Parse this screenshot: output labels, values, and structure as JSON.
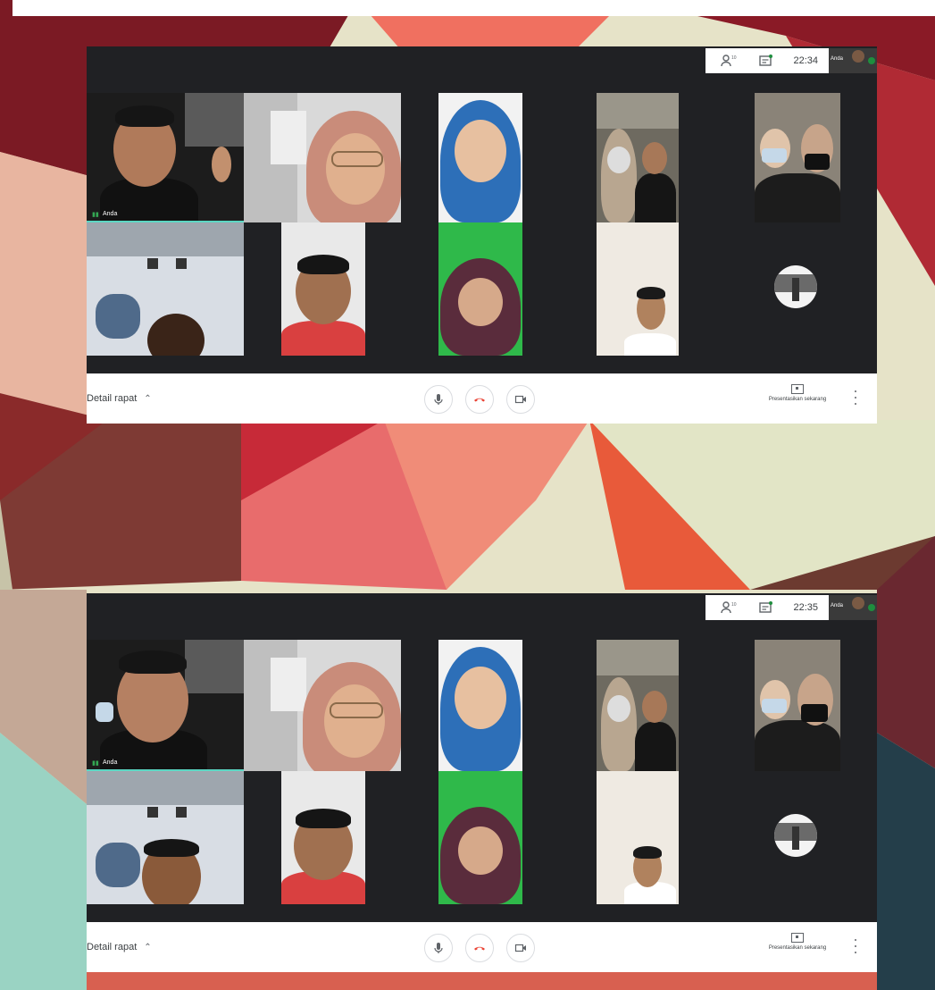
{
  "screens": [
    {
      "clock": "22:34",
      "self_label": "Anda",
      "first_tile_name": "Anda",
      "detail_label": "Detail rapat",
      "present_label": "Presentasikan sekarang"
    },
    {
      "clock": "22:35",
      "self_label": "Anda",
      "first_tile_name": "Anda",
      "detail_label": "Detail rapat",
      "present_label": "Presentasikan sekarang"
    }
  ],
  "icons": {
    "people": "people-icon",
    "chat": "chat-icon",
    "expand": "chevron-up-icon",
    "mic": "microphone-icon",
    "hangup": "hang-up-icon",
    "camera": "camera-icon",
    "present": "present-screen-icon",
    "more": "more-options-icon"
  },
  "colors": {
    "meet_background": "#202124",
    "tile_background": "#3c4043",
    "speaking_indicator": "#5bd7c3",
    "hangup_red": "#ea4335",
    "mic_green": "#34a853"
  }
}
